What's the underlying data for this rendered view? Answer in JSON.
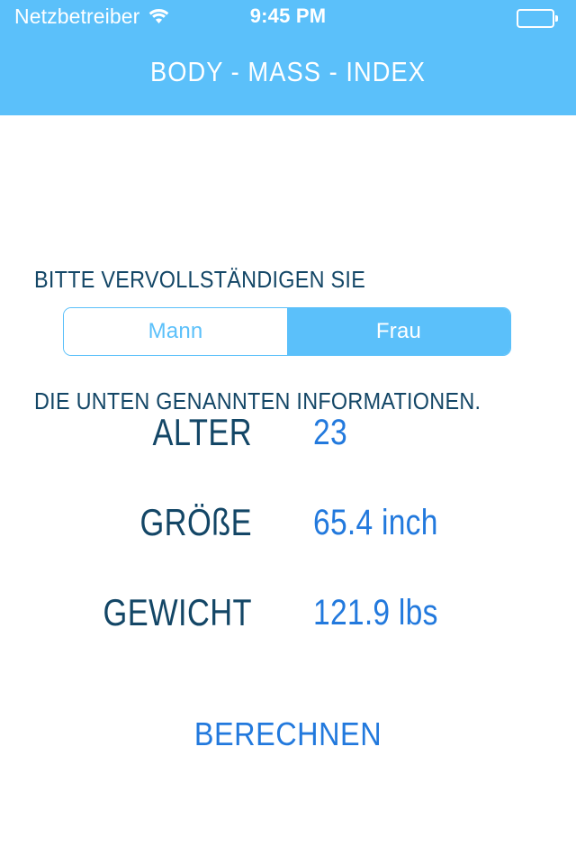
{
  "status_bar": {
    "carrier": "Netzbetreiber",
    "wifi_icon": "wifi-icon",
    "time": "9:45 PM",
    "battery_icon": "battery-icon"
  },
  "header": {
    "title": "BODY - MASS - INDEX",
    "background_color": "#5bc0fa",
    "title_color": "#ffffff"
  },
  "instructions": {
    "line1": "BITTE VERVOLLSTÄNDIGEN SIE",
    "line2": "DIE UNTEN GENANNTEN INFORMATIONEN.",
    "color": "#134666"
  },
  "gender_selector": {
    "options": [
      {
        "label": "Mann",
        "selected": false
      },
      {
        "label": "Frau",
        "selected": true
      }
    ],
    "selected_color": "#5bc0fa",
    "unselected_text_color": "#5bc0fa"
  },
  "fields": [
    {
      "label": "ALTER",
      "value": "23"
    },
    {
      "label": "GRÖßE",
      "value": "65.4 inch"
    },
    {
      "label": "GEWICHT",
      "value": "121.9 lbs"
    }
  ],
  "actions": {
    "calculate_label": "BERECHNEN",
    "calculate_color": "#2279dd"
  },
  "colors": {
    "accent": "#5bc0fa",
    "label_navy": "#134666",
    "value_blue": "#2279dd",
    "page_background": "#ffffff"
  }
}
